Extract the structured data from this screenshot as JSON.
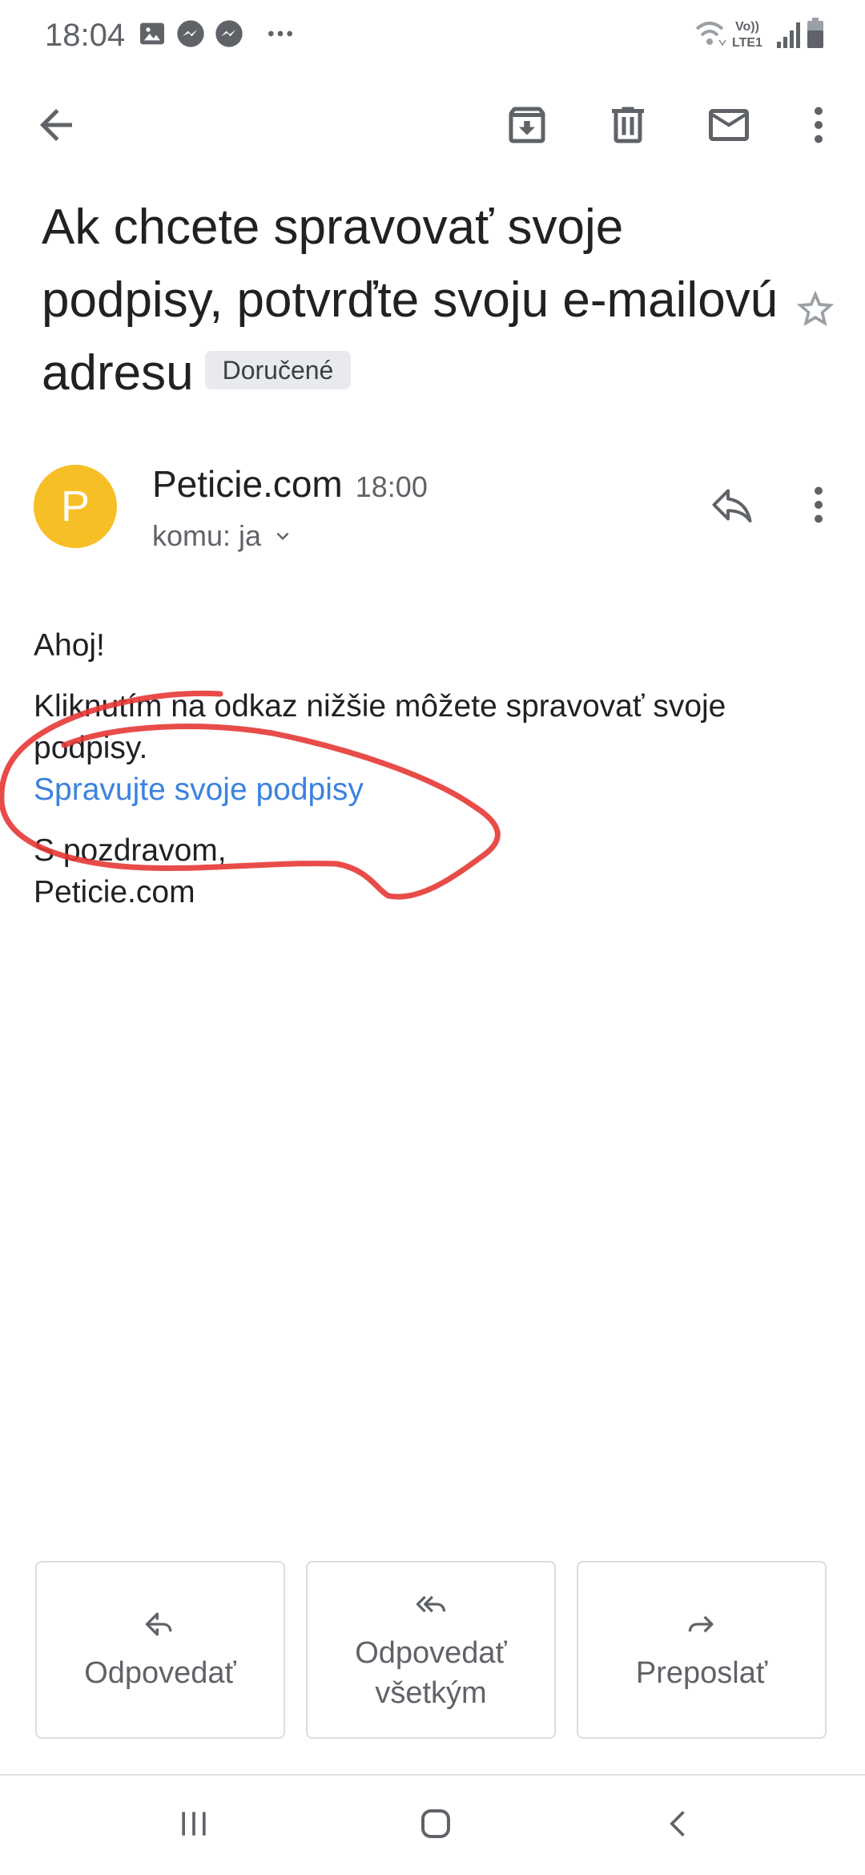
{
  "status_bar": {
    "time": "18:04",
    "left_icons": [
      "gallery-icon",
      "messenger-icon",
      "messenger-icon",
      "more-notifications-icon"
    ],
    "right_icons": [
      "wifi-icon",
      "volte-lte-icon",
      "signal-icon",
      "battery-icon"
    ],
    "network_label_top": "Vo))",
    "network_label_bottom": "LTE1"
  },
  "toolbar": {
    "back": "back-arrow-icon",
    "actions": [
      "archive-icon",
      "delete-icon",
      "mark-unread-icon",
      "more-vert-icon"
    ]
  },
  "email": {
    "subject": "Ak chcete spravovať svoje podpisy, potvrďte svoju e-mailovú adresu",
    "label": "Doručené",
    "starred": false,
    "sender": {
      "avatar_letter": "P",
      "avatar_color": "#f6bf26",
      "name": "Peticie.com",
      "time": "18:00",
      "recipient": "komu: ja"
    },
    "body": {
      "greeting": "Ahoj!",
      "paragraph": "Kliknutím na odkaz nižšie môžete spravovať svoje podpisy.",
      "link_text": "Spravujte svoje podpisy",
      "closing_line1": "S pozdravom,",
      "closing_line2": "Peticie.com"
    }
  },
  "actions": {
    "reply": "Odpovedať",
    "reply_all": "Odpovedať všetkým",
    "forward": "Preposlať"
  },
  "annotation": {
    "color": "#e53935",
    "shape": "hand-drawn-ellipse"
  },
  "colors": {
    "link": "#3b82e0",
    "icon": "#5f6368",
    "chip_bg": "#e8eaed"
  }
}
